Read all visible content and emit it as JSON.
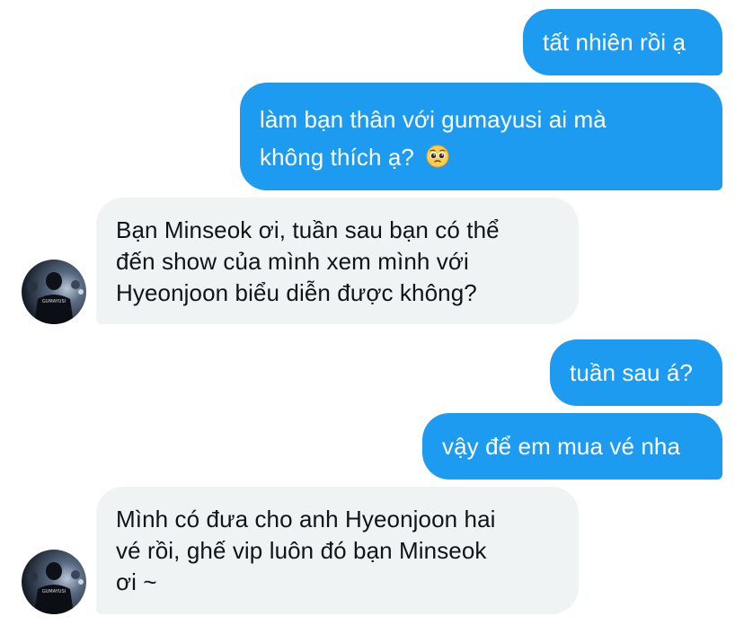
{
  "messages": [
    {
      "id": 1,
      "side": "out",
      "lines": [
        "tất nhiên rồi ạ"
      ]
    },
    {
      "id": 2,
      "side": "out",
      "lines": [
        "làm bạn thân với gumayusi ai mà",
        "không thích ạ?"
      ],
      "emoji": "pleading-face-emoji"
    },
    {
      "id": 3,
      "side": "in",
      "lines": [
        "Bạn Minseok ơi, tuần sau bạn có thể",
        "đến show của mình xem mình với",
        "Hyeonjoon biểu diễn được không?"
      ],
      "avatar_label": "GUMAYUSI"
    },
    {
      "id": 4,
      "side": "out",
      "lines": [
        "tuần sau á?"
      ]
    },
    {
      "id": 5,
      "side": "out",
      "lines": [
        "vậy để em mua vé nha"
      ]
    },
    {
      "id": 6,
      "side": "in",
      "lines": [
        "Mình có đưa cho anh Hyeonjoon hai",
        "vé rồi, ghế vip luôn đó bạn Minseok",
        "ơi ~"
      ],
      "avatar_label": "GUMAYUSI"
    }
  ],
  "colors": {
    "outgoing_bubble": "#1d9bf0",
    "incoming_bubble": "#eff3f4",
    "incoming_text": "#0f1419",
    "outgoing_text": "#ffffff"
  }
}
